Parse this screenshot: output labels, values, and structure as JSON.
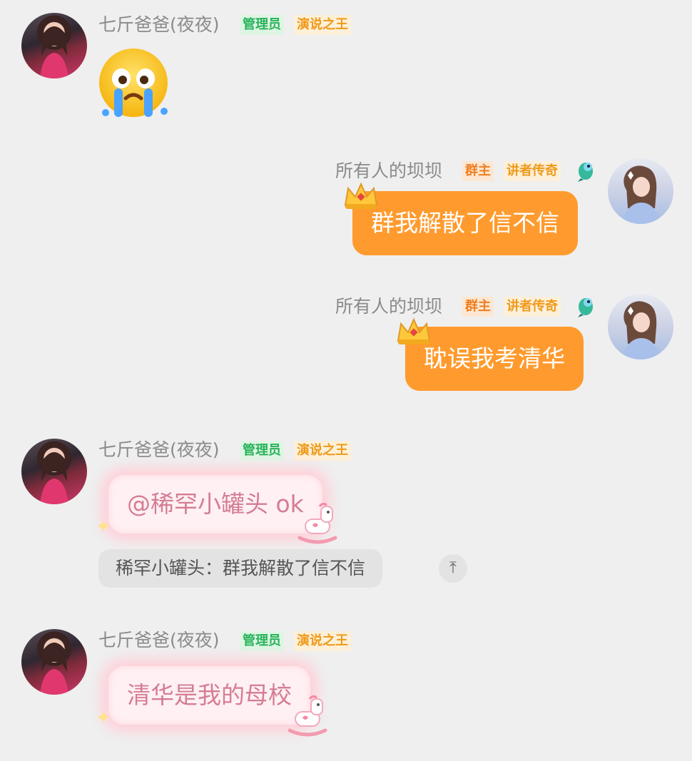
{
  "messages": [
    {
      "sender": "七斤爸爸(夜夜)",
      "tags": [
        "管理员",
        "演说之王"
      ],
      "content_type": "emoji",
      "emoji": "crying-face"
    },
    {
      "sender": "所有人的坝坝",
      "tags": [
        "群主",
        "讲者传奇"
      ],
      "text": "群我解散了信不信"
    },
    {
      "sender": "所有人的坝坝",
      "tags": [
        "群主",
        "讲者传奇"
      ],
      "text": "耽误我考清华"
    },
    {
      "sender": "七斤爸爸(夜夜)",
      "tags": [
        "管理员",
        "演说之王"
      ],
      "text": "@稀罕小罐头 ok",
      "quote": "稀罕小罐头：群我解散了信不信"
    },
    {
      "sender": "七斤爸爸(夜夜)",
      "tags": [
        "管理员",
        "演说之王"
      ],
      "text": "清华是我的母校"
    }
  ],
  "colors": {
    "background": "#efefef",
    "bubble_orange": "#ff9b2e",
    "tag_admin_text": "#27b35a",
    "tag_speech_text": "#ef9a1b",
    "pink_text": "#d47d94"
  }
}
